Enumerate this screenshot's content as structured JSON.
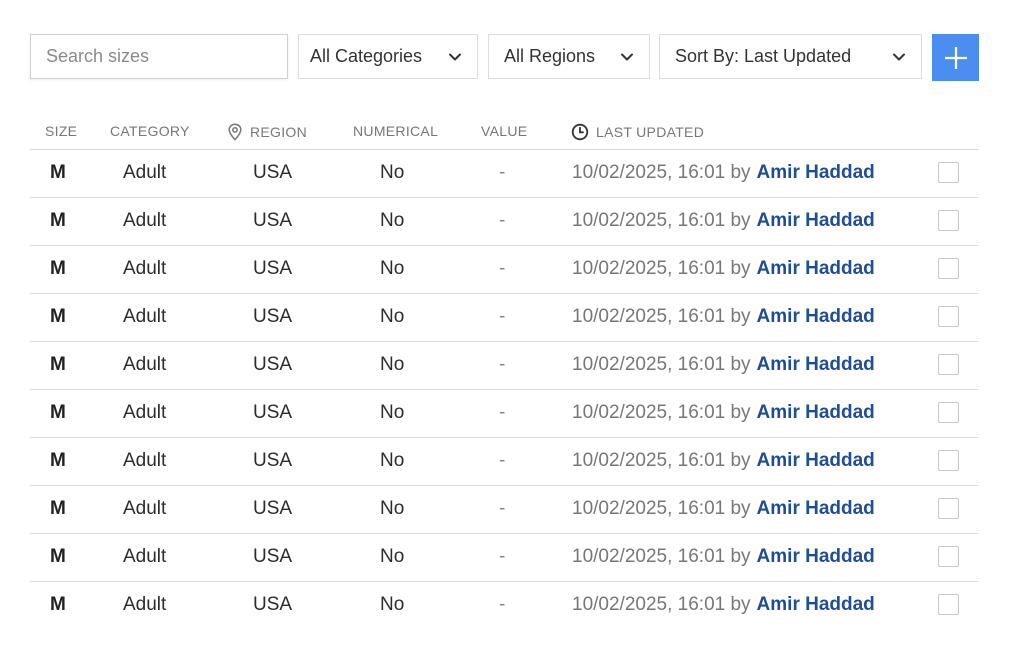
{
  "toolbar": {
    "search_placeholder": "Search sizes",
    "category_filter": "All Categories",
    "region_filter": "All Regions",
    "sort_select": "Sort By: Last Updated"
  },
  "colors": {
    "accent": "#4c8df1",
    "user_link": "#1f4e96"
  },
  "table": {
    "headers": {
      "size": "SIZE",
      "category": "CATEGORY",
      "region": "REGION",
      "numerical": "NUMERICAL",
      "value": "VALUE",
      "last_updated": "LAST UPDATED"
    },
    "rows": [
      {
        "size": "M",
        "category": "Adult",
        "region": "USA",
        "numerical": "No",
        "value": "-",
        "updated": "10/02/2025, 16:01 by",
        "user": "Amir Haddad"
      },
      {
        "size": "M",
        "category": "Adult",
        "region": "USA",
        "numerical": "No",
        "value": "-",
        "updated": "10/02/2025, 16:01 by",
        "user": "Amir Haddad"
      },
      {
        "size": "M",
        "category": "Adult",
        "region": "USA",
        "numerical": "No",
        "value": "-",
        "updated": "10/02/2025, 16:01 by",
        "user": "Amir Haddad"
      },
      {
        "size": "M",
        "category": "Adult",
        "region": "USA",
        "numerical": "No",
        "value": "-",
        "updated": "10/02/2025, 16:01 by",
        "user": "Amir Haddad"
      },
      {
        "size": "M",
        "category": "Adult",
        "region": "USA",
        "numerical": "No",
        "value": "-",
        "updated": "10/02/2025, 16:01 by",
        "user": "Amir Haddad"
      },
      {
        "size": "M",
        "category": "Adult",
        "region": "USA",
        "numerical": "No",
        "value": "-",
        "updated": "10/02/2025, 16:01 by",
        "user": "Amir Haddad"
      },
      {
        "size": "M",
        "category": "Adult",
        "region": "USA",
        "numerical": "No",
        "value": "-",
        "updated": "10/02/2025, 16:01 by",
        "user": "Amir Haddad"
      },
      {
        "size": "M",
        "category": "Adult",
        "region": "USA",
        "numerical": "No",
        "value": "-",
        "updated": "10/02/2025, 16:01 by",
        "user": "Amir Haddad"
      },
      {
        "size": "M",
        "category": "Adult",
        "region": "USA",
        "numerical": "No",
        "value": "-",
        "updated": "10/02/2025, 16:01 by",
        "user": "Amir Haddad"
      },
      {
        "size": "M",
        "category": "Adult",
        "region": "USA",
        "numerical": "No",
        "value": "-",
        "updated": "10/02/2025, 16:01 by",
        "user": "Amir Haddad"
      }
    ]
  }
}
